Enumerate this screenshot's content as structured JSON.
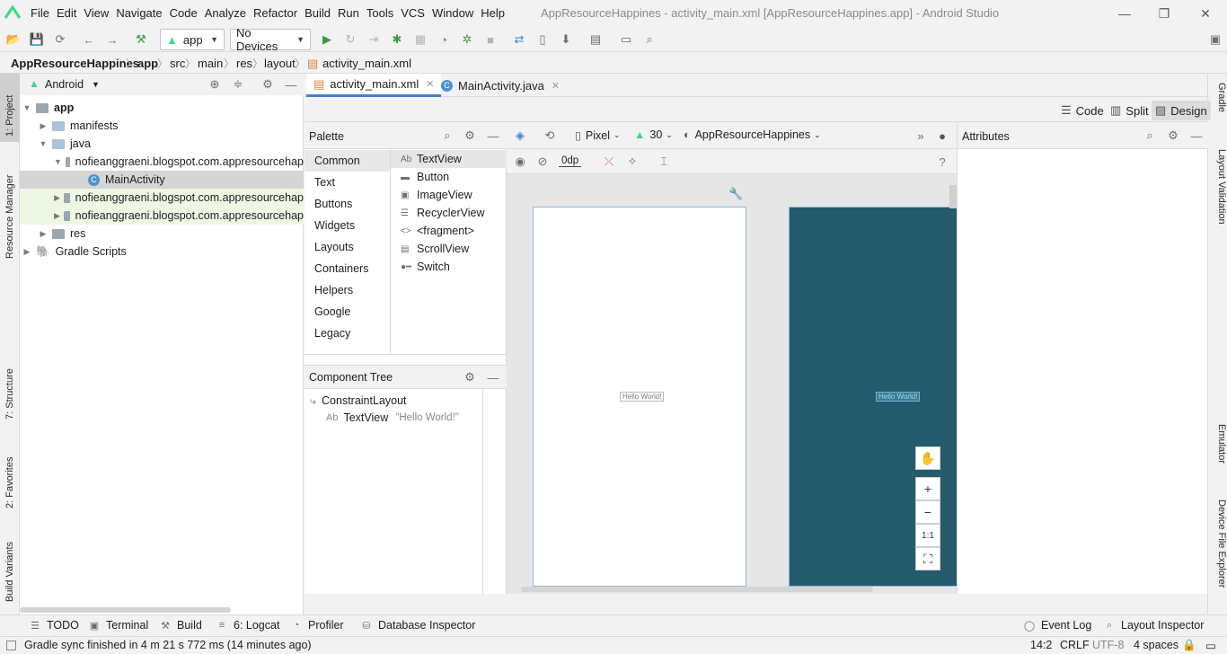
{
  "window": {
    "title": "AppResourceHappines - activity_main.xml [AppResourceHappines.app] - Android Studio",
    "menu": [
      "File",
      "Edit",
      "View",
      "Navigate",
      "Code",
      "Analyze",
      "Refactor",
      "Build",
      "Run",
      "Tools",
      "VCS",
      "Window",
      "Help"
    ],
    "controls": {
      "minimize": "—",
      "maximize": "❐",
      "close": "✕"
    }
  },
  "toolbar": {
    "run_config": "app",
    "device": "No Devices"
  },
  "breadcrumb": [
    "AppResourceHappines",
    "app",
    "src",
    "main",
    "res",
    "layout",
    "activity_main.xml"
  ],
  "left_stripe": [
    "1: Project",
    "Resource Manager",
    "7: Structure",
    "2: Favorites",
    "Build Variants"
  ],
  "right_stripe": [
    "Gradle",
    "Layout Validation",
    "Emulator",
    "Device File Explorer"
  ],
  "project": {
    "view_mode": "Android",
    "tree": [
      {
        "label": "app",
        "bold": true
      },
      {
        "label": "manifests"
      },
      {
        "label": "java"
      },
      {
        "label": "nofieanggraeni.blogspot.com.appresourcehap"
      },
      {
        "label": "MainActivity",
        "badge": "C"
      },
      {
        "label": "nofieanggraeni.blogspot.com.appresourcehap"
      },
      {
        "label": "nofieanggraeni.blogspot.com.appresourcehap"
      },
      {
        "label": "res"
      },
      {
        "label": "Gradle Scripts"
      }
    ]
  },
  "editor": {
    "tabs": [
      {
        "label": "activity_main.xml",
        "active": true
      },
      {
        "label": "MainActivity.java",
        "badge": "C",
        "active": false
      }
    ],
    "view_modes": [
      "Code",
      "Split",
      "Design"
    ],
    "selected_mode": "Design"
  },
  "palette": {
    "title": "Palette",
    "categories": [
      "Common",
      "Text",
      "Buttons",
      "Widgets",
      "Layouts",
      "Containers",
      "Helpers",
      "Google",
      "Legacy"
    ],
    "selected_category": "Common",
    "items": [
      {
        "icon": "Ab",
        "label": "TextView"
      },
      {
        "icon": "▬",
        "label": "Button"
      },
      {
        "icon": "▣",
        "label": "ImageView"
      },
      {
        "icon": "☰",
        "label": "RecyclerView"
      },
      {
        "icon": "<>",
        "label": "<fragment>"
      },
      {
        "icon": "▤",
        "label": "ScrollView"
      },
      {
        "icon": "●━",
        "label": "Switch"
      }
    ]
  },
  "component_tree": {
    "title": "Component Tree",
    "root": "ConstraintLayout",
    "child_label": "TextView",
    "child_value": "\"Hello World!\""
  },
  "design": {
    "device": "Pixel",
    "api": "30",
    "theme": "AppResourceHappines",
    "margin": "0dp",
    "hello_text": "Hello World!",
    "zoom": {
      "pan": "✋",
      "in": "+",
      "out": "−",
      "fit": "1:1",
      "screen": "⛶"
    }
  },
  "attributes": {
    "title": "Attributes"
  },
  "bottom_tools": {
    "left": [
      "TODO",
      "Terminal",
      "Build",
      "6: Logcat",
      "Profiler",
      "Database Inspector"
    ],
    "right": [
      "Event Log",
      "Layout Inspector"
    ]
  },
  "status": {
    "message": "Gradle sync finished in 4 m 21 s 772 ms (14 minutes ago)",
    "position": "14:2",
    "line_sep": "CRLF",
    "encoding": "UTF-8",
    "indent": "4 spaces"
  },
  "colors": {
    "accent": "#4083c9",
    "blueprint": "#245b6c",
    "android_green": "#3ddc84"
  }
}
